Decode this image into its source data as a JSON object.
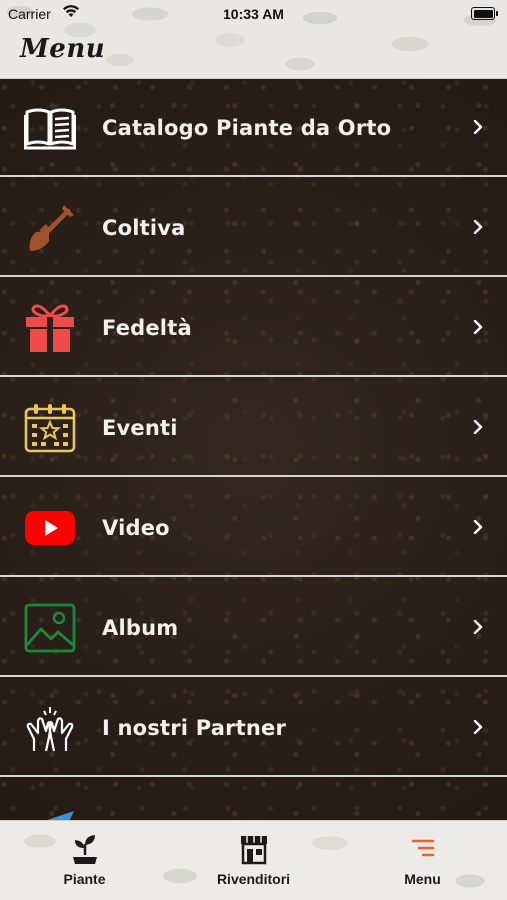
{
  "status_bar": {
    "carrier": "Carrier",
    "time": "10:33 AM"
  },
  "header": {
    "title": "Menu"
  },
  "menu": {
    "items": [
      {
        "label": "Catalogo Piante da Orto",
        "icon": "book-icon",
        "color": "#ffffff"
      },
      {
        "label": "Coltiva",
        "icon": "shovel-icon",
        "color": "#a0522d"
      },
      {
        "label": "Fedeltà",
        "icon": "gift-icon",
        "color": "#f04a4a"
      },
      {
        "label": "Eventi",
        "icon": "calendar-star-icon",
        "color": "#e8c85a"
      },
      {
        "label": "Video",
        "icon": "youtube-icon",
        "color": "#ff0000"
      },
      {
        "label": "Album",
        "icon": "image-icon",
        "color": "#1a8a3a"
      },
      {
        "label": "I nostri Partner",
        "icon": "handshake-icon",
        "color": "#ffffff"
      }
    ]
  },
  "tab_bar": {
    "tabs": [
      {
        "label": "Piante",
        "icon": "seedling-icon",
        "active": false
      },
      {
        "label": "Rivenditori",
        "icon": "shop-icon",
        "active": false
      },
      {
        "label": "Menu",
        "icon": "menu-lines-icon",
        "active": true
      }
    ],
    "active_color": "#e8622a"
  }
}
